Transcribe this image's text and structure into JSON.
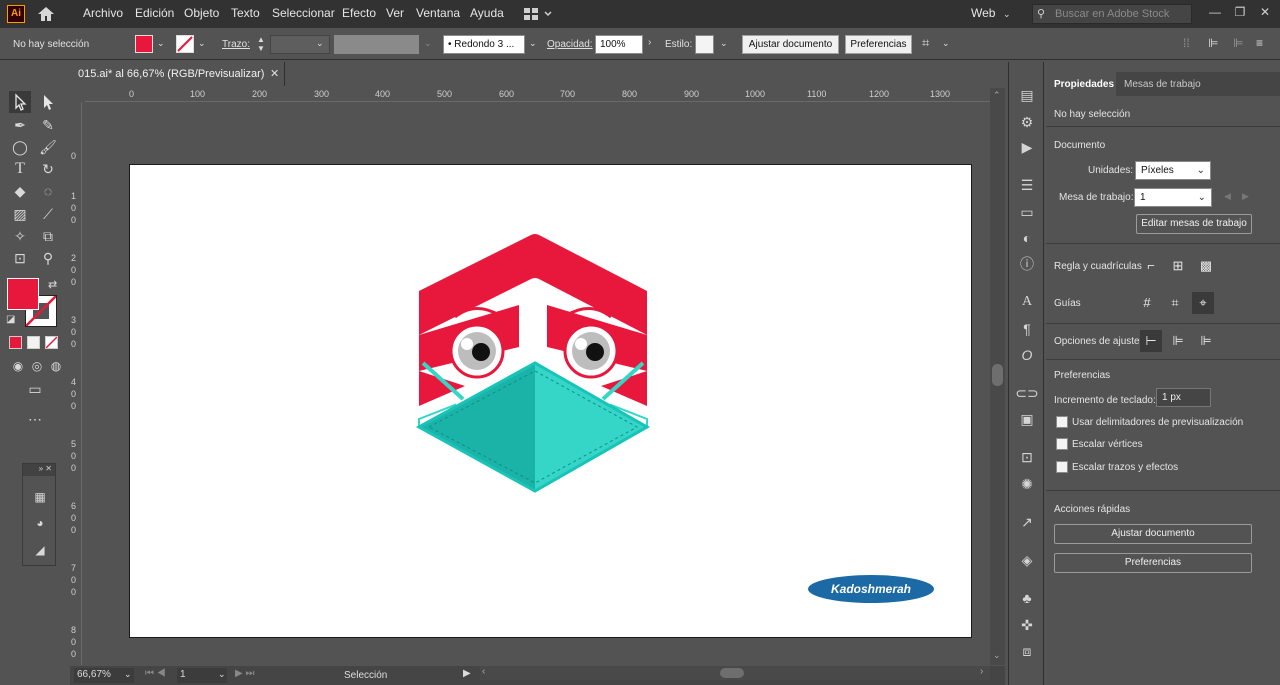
{
  "app": {
    "logo": "Ai",
    "menu": [
      "Archivo",
      "Edición",
      "Objeto",
      "Texto",
      "Seleccionar",
      "Efecto",
      "Ver",
      "Ventana",
      "Ayuda"
    ],
    "workspace": "Web",
    "search_placeholder": "Buscar en Adobe Stock"
  },
  "control": {
    "selection_status": "No hay selección",
    "fill_color": "#e8183c",
    "stroke_label": "Trazo:",
    "brush": "Redondo 3 ...",
    "opacity_label": "Opacidad:",
    "opacity_value": "100%",
    "style_label": "Estilo:",
    "fit_document": "Ajustar documento",
    "preferences": "Preferencias"
  },
  "document": {
    "tab_title": "015.ai* al 66,67% (RGB/Previsualizar)",
    "ruler_h": [
      "0",
      "100",
      "200",
      "300",
      "400",
      "500",
      "600",
      "700",
      "800",
      "900",
      "1000",
      "1100",
      "1200",
      "1300"
    ],
    "ruler_v": [
      "0",
      "1\n0\n0",
      "2\n0\n0",
      "3\n0\n0",
      "4\n0\n0",
      "5\n0\n0",
      "6\n0\n0",
      "7\n0\n0",
      "8\n0\n0"
    ],
    "watermark": "Kadoshmerah"
  },
  "status": {
    "zoom": "66,67%",
    "artboard_num": "1",
    "tool": "Selección"
  },
  "panel": {
    "tabs": [
      "Propiedades",
      "Mesas de trabajo"
    ],
    "selection": "No hay selección",
    "document_heading": "Documento",
    "units_label": "Unidades:",
    "units_value": "Píxeles",
    "artboard_label": "Mesa de trabajo:",
    "artboard_value": "1",
    "edit_artboards": "Editar mesas de trabajo",
    "rulers_label": "Regla y cuadrículas",
    "guides_label": "Guías",
    "snap_label": "Opciones de ajuste",
    "prefs_heading": "Preferencias",
    "keyboard_inc_label": "Incremento de teclado:",
    "keyboard_inc_value": "1 px",
    "check_preview_bounds": "Usar delimitadores de previsualización",
    "check_scale_corners": "Escalar vértices",
    "check_scale_strokes": "Escalar trazos y efectos",
    "quick_actions_heading": "Acciones rápidas",
    "quick_fit": "Ajustar documento",
    "quick_prefs": "Preferencias"
  },
  "colors": {
    "brand_red": "#e8183c",
    "mask_teal": "#1bb3a8",
    "mask_light": "#35d6c8",
    "watermark_blue": "#1c6aa5"
  }
}
